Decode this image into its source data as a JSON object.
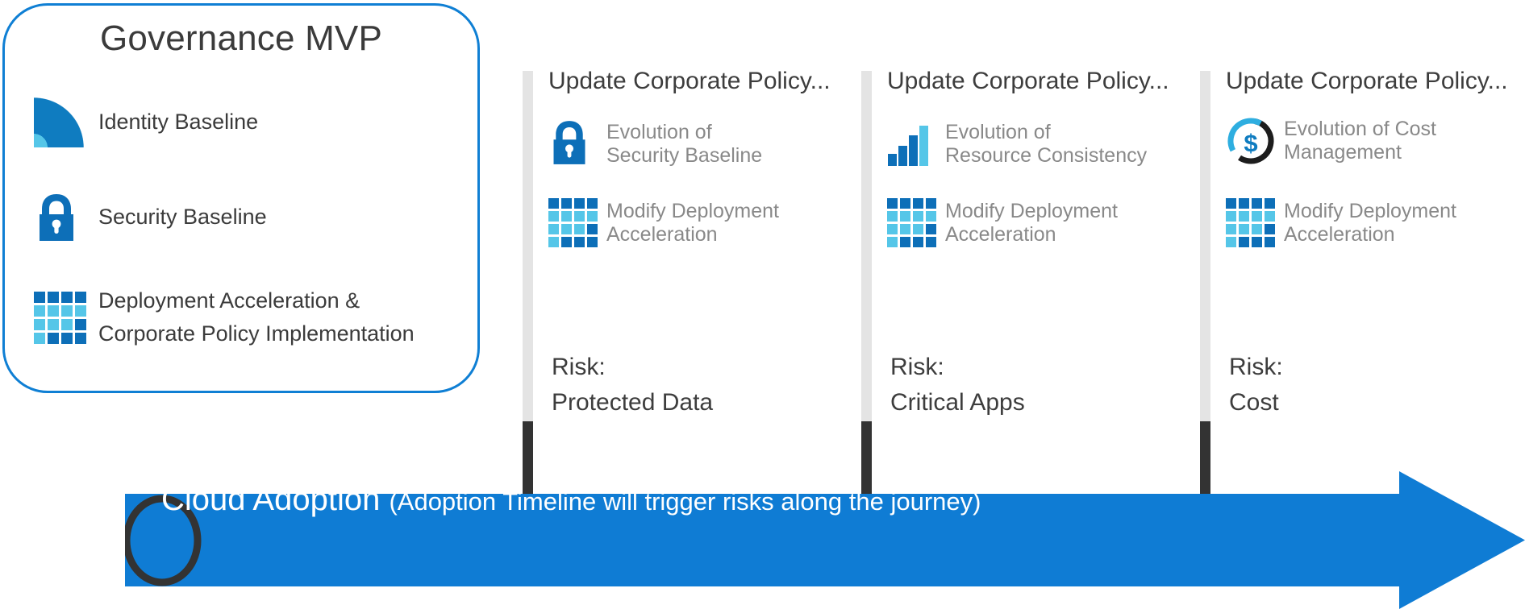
{
  "panel": {
    "title": "Governance MVP",
    "items": [
      {
        "icon": "quarter-circle-icon",
        "label": "Identity Baseline"
      },
      {
        "icon": "lock-icon",
        "label": "Security Baseline"
      },
      {
        "icon": "grid-icon",
        "label": "Deployment Acceleration &\nCorporate Policy Implementation"
      }
    ]
  },
  "columns": [
    {
      "heading": "Update Corporate Policy...",
      "items": [
        {
          "icon": "lock-icon",
          "label": "Evolution of\nSecurity Baseline"
        },
        {
          "icon": "grid-icon",
          "label": "Modify Deployment\nAcceleration"
        }
      ],
      "risk": "Risk:\nProtected Data"
    },
    {
      "heading": "Update Corporate Policy...",
      "items": [
        {
          "icon": "bar-chart-icon",
          "label": "Evolution of\nResource Consistency"
        },
        {
          "icon": "grid-icon",
          "label": "Modify Deployment\nAcceleration"
        }
      ],
      "risk": "Risk:\nCritical Apps"
    },
    {
      "heading": "Update Corporate Policy...",
      "items": [
        {
          "icon": "cost-dollar-icon",
          "label": "Evolution of Cost\nManagement"
        },
        {
          "icon": "grid-icon",
          "label": "Modify Deployment\nAcceleration"
        }
      ],
      "risk": "Risk:\nCost"
    }
  ],
  "timeline": {
    "title": "Cloud Adoption",
    "subtitle": "(Adoption Timeline will trigger risks along the journey)",
    "start_marker": "circle-start-marker"
  },
  "colors": {
    "accent_blue": "#0f7fd4",
    "arrow_blue": "#0f7cd4",
    "icon_dark_blue": "#0d6fb8",
    "icon_light_blue": "#55c6e8",
    "bar_light": "#e4e4e4",
    "bar_dark": "#333333",
    "text_dark": "#3b3b3b",
    "text_muted": "#898989",
    "marker_outline": "#333333"
  }
}
